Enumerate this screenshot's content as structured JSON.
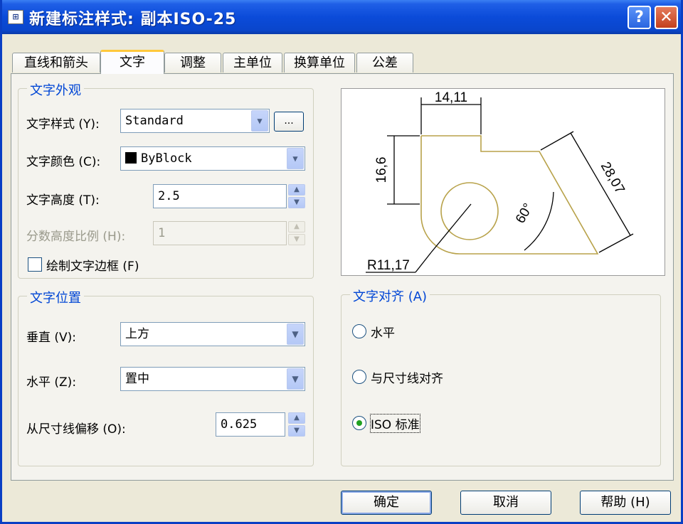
{
  "window": {
    "title": "新建标注样式: 副本ISO-25",
    "app_icon": "app-icon",
    "help_label": "?",
    "close_label": "✕"
  },
  "tabs": [
    {
      "label": "直线和箭头"
    },
    {
      "label": "文字"
    },
    {
      "label": "调整"
    },
    {
      "label": "主单位"
    },
    {
      "label": "换算单位"
    },
    {
      "label": "公差"
    }
  ],
  "appearance": {
    "legend": "文字外观",
    "style_label": "文字样式 (Y):",
    "style_value": "Standard",
    "browse_label": "...",
    "color_label": "文字颜色 (C):",
    "color_value": "ByBlock",
    "height_label": "文字高度 (T):",
    "height_value": "2.5",
    "fraction_label": "分数高度比例 (H):",
    "fraction_value": "1",
    "frame_label": "绘制文字边框 (F)"
  },
  "placement": {
    "legend": "文字位置",
    "vertical_label": "垂直 (V):",
    "vertical_value": "上方",
    "horizontal_label": "水平 (Z):",
    "horizontal_value": "置中",
    "offset_label": "从尺寸线偏移 (O):",
    "offset_value": "0.625"
  },
  "preview": {
    "dim_top": "14,11",
    "dim_left": "16,6",
    "dim_diag": "28,07",
    "dim_angle": "60°",
    "dim_radius": "R11,17"
  },
  "alignment": {
    "legend": "文字对齐 (A)",
    "options": [
      {
        "label": "水平",
        "checked": false
      },
      {
        "label": "与尺寸线对齐",
        "checked": false
      },
      {
        "label": "ISO 标准",
        "checked": true
      }
    ]
  },
  "buttons": {
    "ok": "确定",
    "cancel": "取消",
    "help": "帮助 (H)"
  },
  "colors": {
    "title_blue": "#0b4bd9",
    "legend_blue": "#0046d5",
    "preview_line": "#b8a24a",
    "tab_active_accent": "#ffc83c"
  }
}
